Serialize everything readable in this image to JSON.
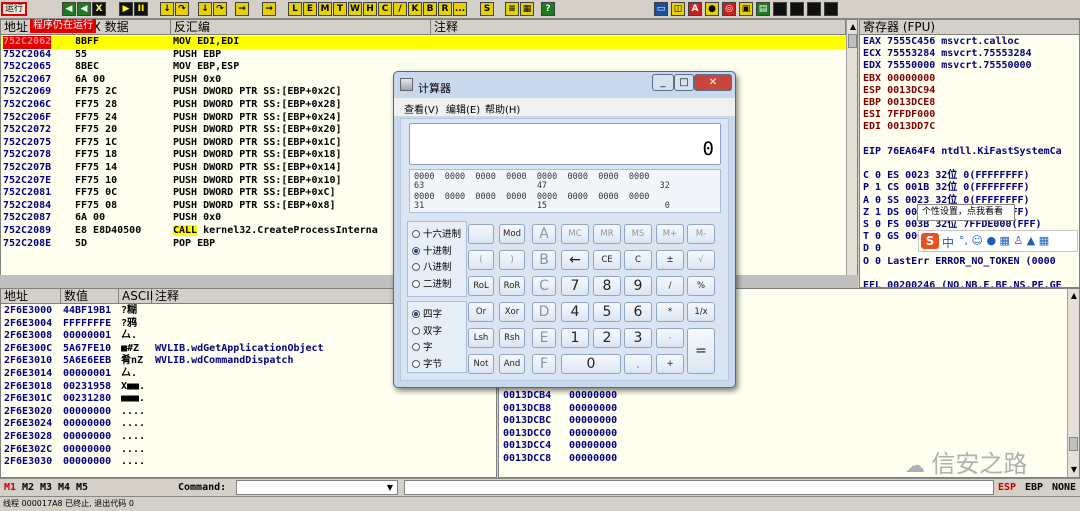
{
  "toolbar": {
    "run_label": "运行",
    "annotation": "程序仍在运行",
    "buttons": [
      "<<",
      "X",
      "▶",
      "II",
      "L",
      "E",
      "M",
      "T",
      "W",
      "H",
      "C",
      "/",
      "K",
      "B",
      "R",
      "...",
      "S"
    ]
  },
  "disasm": {
    "headers": [
      "地址",
      "HEX 数据",
      "反汇编",
      "注释"
    ],
    "rows": [
      {
        "a": "752C2062",
        "h": "8BFF",
        "m": "MOV EDI,EDI"
      },
      {
        "a": "752C2064",
        "h": "55",
        "m": "PUSH EBP"
      },
      {
        "a": "752C2065",
        "h": "8BEC",
        "m": "MOV EBP,ESP"
      },
      {
        "a": "752C2067",
        "h": "6A 00",
        "m": "PUSH 0x0"
      },
      {
        "a": "752C2069",
        "h": "FF75 2C",
        "m": "PUSH DWORD PTR SS:[EBP+0x2C]"
      },
      {
        "a": "752C206C",
        "h": "FF75 28",
        "m": "PUSH DWORD PTR SS:[EBP+0x28]"
      },
      {
        "a": "752C206F",
        "h": "FF75 24",
        "m": "PUSH DWORD PTR SS:[EBP+0x24]"
      },
      {
        "a": "752C2072",
        "h": "FF75 20",
        "m": "PUSH DWORD PTR SS:[EBP+0x20]"
      },
      {
        "a": "752C2075",
        "h": "FF75 1C",
        "m": "PUSH DWORD PTR SS:[EBP+0x1C]"
      },
      {
        "a": "752C2078",
        "h": "FF75 18",
        "m": "PUSH DWORD PTR SS:[EBP+0x18]"
      },
      {
        "a": "752C207B",
        "h": "FF75 14",
        "m": "PUSH DWORD PTR SS:[EBP+0x14]"
      },
      {
        "a": "752C207E",
        "h": "FF75 10",
        "m": "PUSH DWORD PTR SS:[EBP+0x10]"
      },
      {
        "a": "752C2081",
        "h": "FF75 0C",
        "m": "PUSH DWORD PTR SS:[EBP+0xC]"
      },
      {
        "a": "752C2084",
        "h": "FF75 08",
        "m": "PUSH DWORD PTR SS:[EBP+0x8]"
      },
      {
        "a": "752C2087",
        "h": "6A 00",
        "m": "PUSH 0x0"
      },
      {
        "a": "752C2089",
        "h": "E8 E8D40500",
        "m_kw": "CALL",
        "m_rest": " kernel32.CreateProcessInterna"
      },
      {
        "a": "752C208E",
        "h": "5D",
        "m": "POP EBP"
      }
    ]
  },
  "registers": {
    "header": "寄存器 (FPU)",
    "lines": [
      {
        "t": "EAX 7555C456 msvcrt.calloc",
        "c": "#000080"
      },
      {
        "t": "ECX 75553284 msvcrt.75553284",
        "c": "#000080"
      },
      {
        "t": "EDX 75550000 msvcrt.75550000",
        "c": "#000080"
      },
      {
        "t": "EBX 00000000",
        "c": "#800000"
      },
      {
        "t": "ESP 0013DC94",
        "c": "#800000"
      },
      {
        "t": "EBP 0013DCE8",
        "c": "#800000"
      },
      {
        "t": "ESI 7FFDF000",
        "c": "#800000"
      },
      {
        "t": "EDI 0013DD7C",
        "c": "#800000"
      },
      {
        "t": "",
        "c": "#000"
      },
      {
        "t": "EIP 76EA64F4 ntdll.KiFastSystemCa",
        "c": "#000080"
      },
      {
        "t": "",
        "c": "#000"
      },
      {
        "t": "C 0  ES 0023 32位 0(FFFFFFFF)",
        "c": "#000080"
      },
      {
        "t": "P 1  CS 001B 32位 0(FFFFFFFF)",
        "c": "#000080"
      },
      {
        "t": "A 0  SS 0023 32位 0(FFFFFFFF)",
        "c": "#000080"
      },
      {
        "t": "Z 1  DS 0023 32位 0(FFFFFFFF)",
        "c": "#000080"
      },
      {
        "t": "S 0  FS 003B 32位 7FFDE000(FFF)",
        "c": "#000080"
      },
      {
        "t": "T 0  GS 0000 NULL",
        "c": "#000080"
      },
      {
        "t": "D 0",
        "c": "#000080"
      },
      {
        "t": "O 0  LastErr ERROR_NO_TOKEN (0000",
        "c": "#000080"
      },
      {
        "t": "",
        "c": "#000"
      },
      {
        "t": "EFL 00200246 (NO,NB,E,BE,NS,PE,GE",
        "c": "#000080"
      }
    ]
  },
  "dump": {
    "headers": [
      "地址",
      "数值",
      "ASCII",
      "注释"
    ],
    "rows": [
      {
        "a": "2F6E3000",
        "v": "44BF19B1",
        "s": "?糊",
        "c": ""
      },
      {
        "a": "2F6E3004",
        "v": "FFFFFFFE",
        "s": "?鸦",
        "c": ""
      },
      {
        "a": "2F6E3008",
        "v": "00000001",
        "s": "厶.",
        "c": ""
      },
      {
        "a": "2F6E300C",
        "v": "5A67FE10",
        "s": "■#Z",
        "c": "WVLIB.wdGetApplicationObject"
      },
      {
        "a": "2F6E3010",
        "v": "5A6E6EEB",
        "s": "肴nZ",
        "c": "WVLIB.wdCommandDispatch"
      },
      {
        "a": "2F6E3014",
        "v": "00000001",
        "s": "厶.",
        "c": ""
      },
      {
        "a": "2F6E3018",
        "v": "00231958",
        "s": "X■■.",
        "c": ""
      },
      {
        "a": "2F6E301C",
        "v": "00231280",
        "s": "■■■.",
        "c": ""
      },
      {
        "a": "2F6E3020",
        "v": "00000000",
        "s": "....",
        "c": ""
      },
      {
        "a": "2F6E3024",
        "v": "00000000",
        "s": "....",
        "c": ""
      },
      {
        "a": "2F6E3028",
        "v": "00000000",
        "s": "....",
        "c": ""
      },
      {
        "a": "2F6E302C",
        "v": "00000000",
        "s": "....",
        "c": ""
      },
      {
        "a": "2F6E3030",
        "v": "00000000",
        "s": "....",
        "c": ""
      }
    ]
  },
  "stack": {
    "rows": [
      {
        "a": "0013DCB4",
        "v": "00000000"
      },
      {
        "a": "0013DCB8",
        "v": "00000000"
      },
      {
        "a": "0013DCBC",
        "v": "00000000"
      },
      {
        "a": "0013DCC0",
        "v": "00000000"
      },
      {
        "a": "0013DCC4",
        "v": "00000000"
      },
      {
        "a": "0013DCC8",
        "v": "00000000"
      }
    ]
  },
  "calc": {
    "title": "计算器",
    "menu": [
      "查看(V)",
      "编辑(E)",
      "帮助(H)"
    ],
    "display": "0",
    "bits": [
      "0000  0000  0000  0000  0000  0000  0000  0000",
      "63                      47                      32",
      "0000  0000  0000  0000  0000  0000  0000  0000",
      "31                      15                       0"
    ],
    "base_options": [
      "十六进制",
      "十进制",
      "八进制",
      "二进制"
    ],
    "base_selected": 1,
    "word_options": [
      "四字",
      "双字",
      "字",
      "字节"
    ],
    "word_selected": 0,
    "keys": [
      [
        "",
        "Mod",
        "A",
        "MC",
        "MR",
        "MS",
        "M+",
        "M-"
      ],
      [
        "(",
        ")",
        "B",
        "←",
        "CE",
        "C",
        "±",
        "√"
      ],
      [
        "RoL",
        "RoR",
        "C",
        "7",
        "8",
        "9",
        "/",
        "%"
      ],
      [
        "Or",
        "Xor",
        "D",
        "4",
        "5",
        "6",
        "*",
        "1/x"
      ],
      [
        "Lsh",
        "Rsh",
        "E",
        "1",
        "2",
        "3",
        "-",
        "="
      ],
      [
        "Not",
        "And",
        "F",
        "0",
        "",
        ".",
        "+",
        ""
      ]
    ]
  },
  "ime": {
    "tooltip": "个性设置，点我看看",
    "label": "中"
  },
  "command": {
    "tabs": [
      "M1",
      "M2",
      "M3",
      "M4",
      "M5"
    ],
    "label": "Command:",
    "regs": [
      "ESP",
      "EBP",
      "NONE"
    ]
  },
  "status": {
    "text": "线程 000017A8 已终止, 退出代码 0"
  },
  "watermark": "信安之路"
}
